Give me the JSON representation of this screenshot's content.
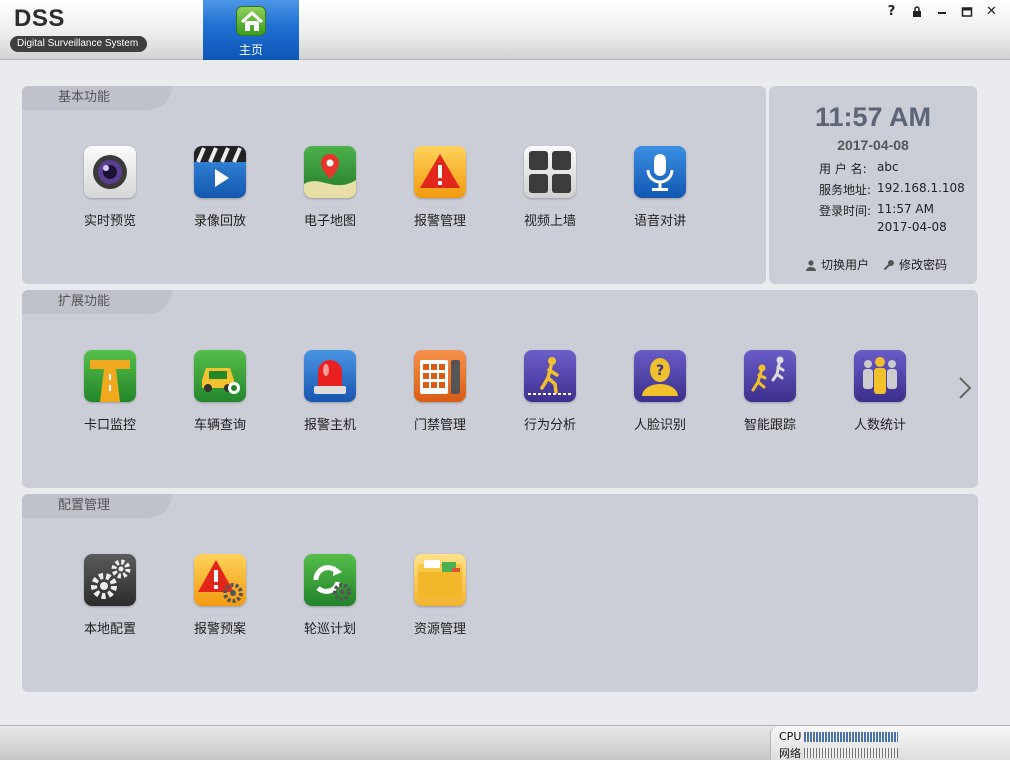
{
  "app": {
    "title": "DSS",
    "subtitle": "Digital Surveillance System"
  },
  "tabs": [
    {
      "label": "主页",
      "icon": "home-icon"
    }
  ],
  "window_controls": [
    {
      "symbol": "?",
      "name": "help"
    },
    {
      "symbol": "lock",
      "name": "lock"
    },
    {
      "symbol": "–",
      "name": "minimize"
    },
    {
      "symbol": "maximize",
      "name": "maximize"
    },
    {
      "symbol": "✕",
      "name": "close"
    }
  ],
  "panels": {
    "basic": {
      "title": "基本功能",
      "items": [
        {
          "label": "实时预览",
          "icon": "camera-icon"
        },
        {
          "label": "录像回放",
          "icon": "playback-icon"
        },
        {
          "label": "电子地图",
          "icon": "map-icon"
        },
        {
          "label": "报警管理",
          "icon": "alarm-icon"
        },
        {
          "label": "视频上墙",
          "icon": "video-wall-icon"
        },
        {
          "label": "语音对讲",
          "icon": "microphone-icon"
        }
      ]
    },
    "extended": {
      "title": "扩展功能",
      "items": [
        {
          "label": "卡口监控",
          "icon": "checkpoint-icon"
        },
        {
          "label": "车辆查询",
          "icon": "vehicle-search-icon"
        },
        {
          "label": "报警主机",
          "icon": "alarm-host-icon"
        },
        {
          "label": "门禁管理",
          "icon": "access-control-icon"
        },
        {
          "label": "行为分析",
          "icon": "behavior-analysis-icon"
        },
        {
          "label": "人脸识别",
          "icon": "face-recognition-icon"
        },
        {
          "label": "智能跟踪",
          "icon": "smart-tracking-icon"
        },
        {
          "label": "人数统计",
          "icon": "people-counting-icon"
        }
      ]
    },
    "config": {
      "title": "配置管理",
      "items": [
        {
          "label": "本地配置",
          "icon": "local-config-icon"
        },
        {
          "label": "报警预案",
          "icon": "alarm-plan-icon"
        },
        {
          "label": "轮巡计划",
          "icon": "tour-plan-icon"
        },
        {
          "label": "资源管理",
          "icon": "resource-folder-icon"
        }
      ]
    }
  },
  "info": {
    "time": "11:57 AM",
    "date": "2017-04-08",
    "user_key": "用 户 名:",
    "user_val": "abc",
    "server_key": "服务地址:",
    "server_val": "192.168.1.108",
    "login_key": "登录时间:",
    "login_time": "11:57 AM",
    "login_date": "2017-04-08",
    "switch_user": "切换用户",
    "change_password": "修改密码"
  },
  "status": {
    "cpu_label": "CPU",
    "net_label": "网络"
  },
  "colors": {
    "accent": "#1f6fd1",
    "panel": "#cbced6",
    "panel_tab": "#bfc2cb"
  }
}
